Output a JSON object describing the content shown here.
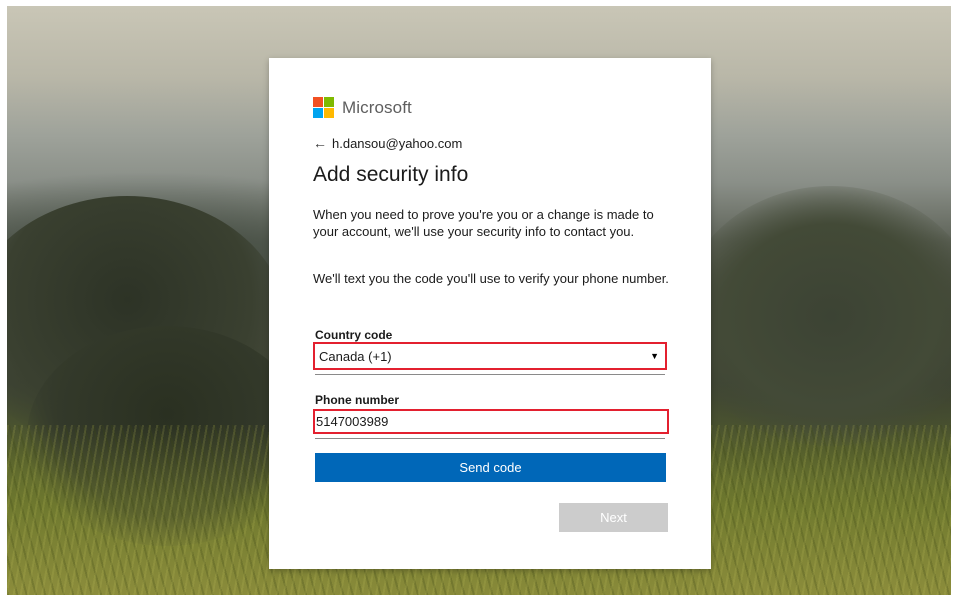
{
  "brand": {
    "name": "Microsoft",
    "logo_colors": [
      "#f25022",
      "#7fba00",
      "#00a4ef",
      "#ffb900"
    ]
  },
  "identity": {
    "back_icon": "left-arrow-icon",
    "email": "h.dansou@yahoo.com"
  },
  "page": {
    "title": "Add security info",
    "description": "When you need to prove you're you or a change is made to your account, we'll use your security info to contact you.",
    "sms_note": "We'll text you the code you'll use to verify your phone number."
  },
  "form": {
    "country_label": "Country code",
    "country_selected": "Canada (+1)",
    "phone_label": "Phone number",
    "phone_value": "5147003989",
    "highlight_color": "#e3202f"
  },
  "actions": {
    "send_code_label": "Send code",
    "next_label": "Next",
    "primary_color": "#0067b8",
    "disabled_color": "#cccccc"
  }
}
